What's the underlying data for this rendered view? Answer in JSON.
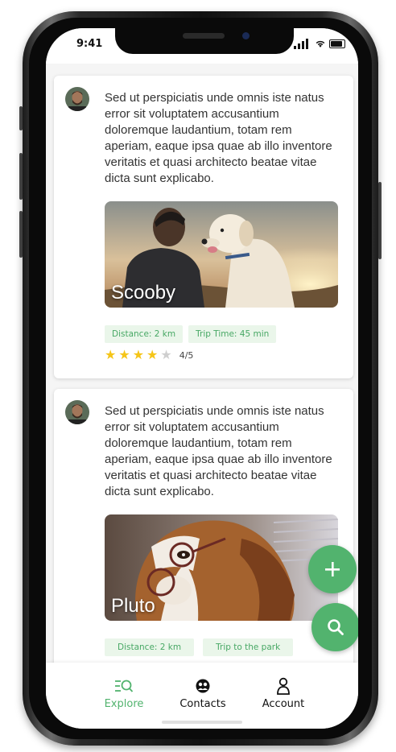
{
  "status_bar": {
    "time": "9:41"
  },
  "posts": [
    {
      "text": "Sed ut perspiciatis unde omnis iste natus error sit voluptatem accusantium doloremque laudantium, totam rem aperiam, eaque ipsa quae ab illo inventore veritatis et quasi architecto beatae vitae dicta sunt explicabo.",
      "photo_label": "Scooby",
      "tags": [
        "Distance: 2 km",
        "Trip Time: 45 min"
      ],
      "rating": {
        "value": 4,
        "max": 5,
        "text": "4/5"
      }
    },
    {
      "text": "Sed ut perspiciatis unde omnis iste natus error sit voluptatem accusantium doloremque laudantium, totam rem aperiam, eaque ipsa quae ab illo inventore veritatis et quasi architecto beatae vitae dicta sunt explicabo.",
      "photo_label": "Pluto",
      "tags": [
        "Distance: 2 km",
        "Trip to the park"
      ]
    }
  ],
  "fabs": {
    "add_icon": "plus-icon",
    "search_icon": "search-icon"
  },
  "nav": {
    "items": [
      {
        "label": "Explore",
        "icon": "explore-icon",
        "active": true
      },
      {
        "label": "Contacts",
        "icon": "contacts-icon",
        "active": false
      },
      {
        "label": "Account",
        "icon": "account-icon",
        "active": false
      }
    ]
  },
  "colors": {
    "accent": "#52b36e",
    "tag_bg": "#eaf6ea",
    "tag_text": "#48a865",
    "star": "#f5c518"
  }
}
